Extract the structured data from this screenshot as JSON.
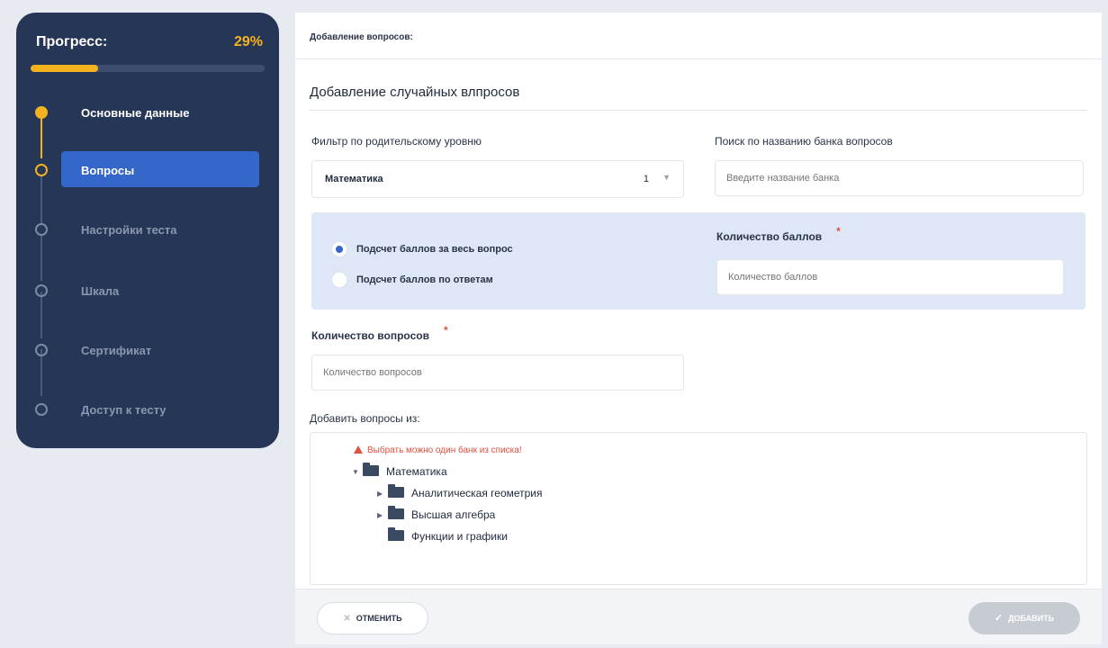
{
  "sidebar": {
    "progress_title": "Прогресс:",
    "progress_value": "29%",
    "progress_fraction": 0.29,
    "steps": [
      {
        "label": "Основные данные",
        "state": "done"
      },
      {
        "label": "Вопросы",
        "state": "current"
      },
      {
        "label": "Настройки теста",
        "state": "pending"
      },
      {
        "label": "Шкала",
        "state": "pending"
      },
      {
        "label": "Сертификат",
        "state": "pending"
      },
      {
        "label": "Доступ к тесту",
        "state": "pending"
      }
    ]
  },
  "main": {
    "header_title": "Добавление вопросов:",
    "section_title": "Добавление случайных влпросов",
    "filter_label": "Фильтр по родительскому уровню",
    "filter_value": "Математика",
    "filter_count": "1",
    "search_label": "Поиск по названию банка вопросов",
    "search_placeholder": "Введите название банка",
    "score_mode": {
      "option_whole": "Подсчет баллов за весь вопрос",
      "option_answers": "Подсчет баллов по ответам",
      "selected": "option_whole"
    },
    "score_label": "Количество баллов",
    "score_placeholder": "Количество баллов",
    "questions_label": "Количество вопросов",
    "questions_placeholder": "Количество вопросов",
    "required_mark": "*",
    "add_from_label": "Добавить вопросы из:",
    "warning": "Выбрать можно один банк из списка!",
    "tree": {
      "root": "Математика",
      "children": [
        "Аналитическая геометрия",
        "Высшая алгебра",
        "Функции и графики"
      ]
    }
  },
  "footer": {
    "cancel_label": "ОТМЕНИТЬ",
    "add_label": "ДОБАВИТЬ"
  },
  "colors": {
    "sidebar_bg": "#263656",
    "accent_yellow": "#f4b21f",
    "active_blue": "#3566c9",
    "panel_blue": "#dde7f6",
    "error_red": "#e0503a"
  },
  "icons": {
    "select_arrow": "chevron-down-icon",
    "warning": "warning-icon",
    "folder": "folder-icon",
    "caret": "caret-icon",
    "cancel": "close-icon",
    "add": "check-icon"
  }
}
